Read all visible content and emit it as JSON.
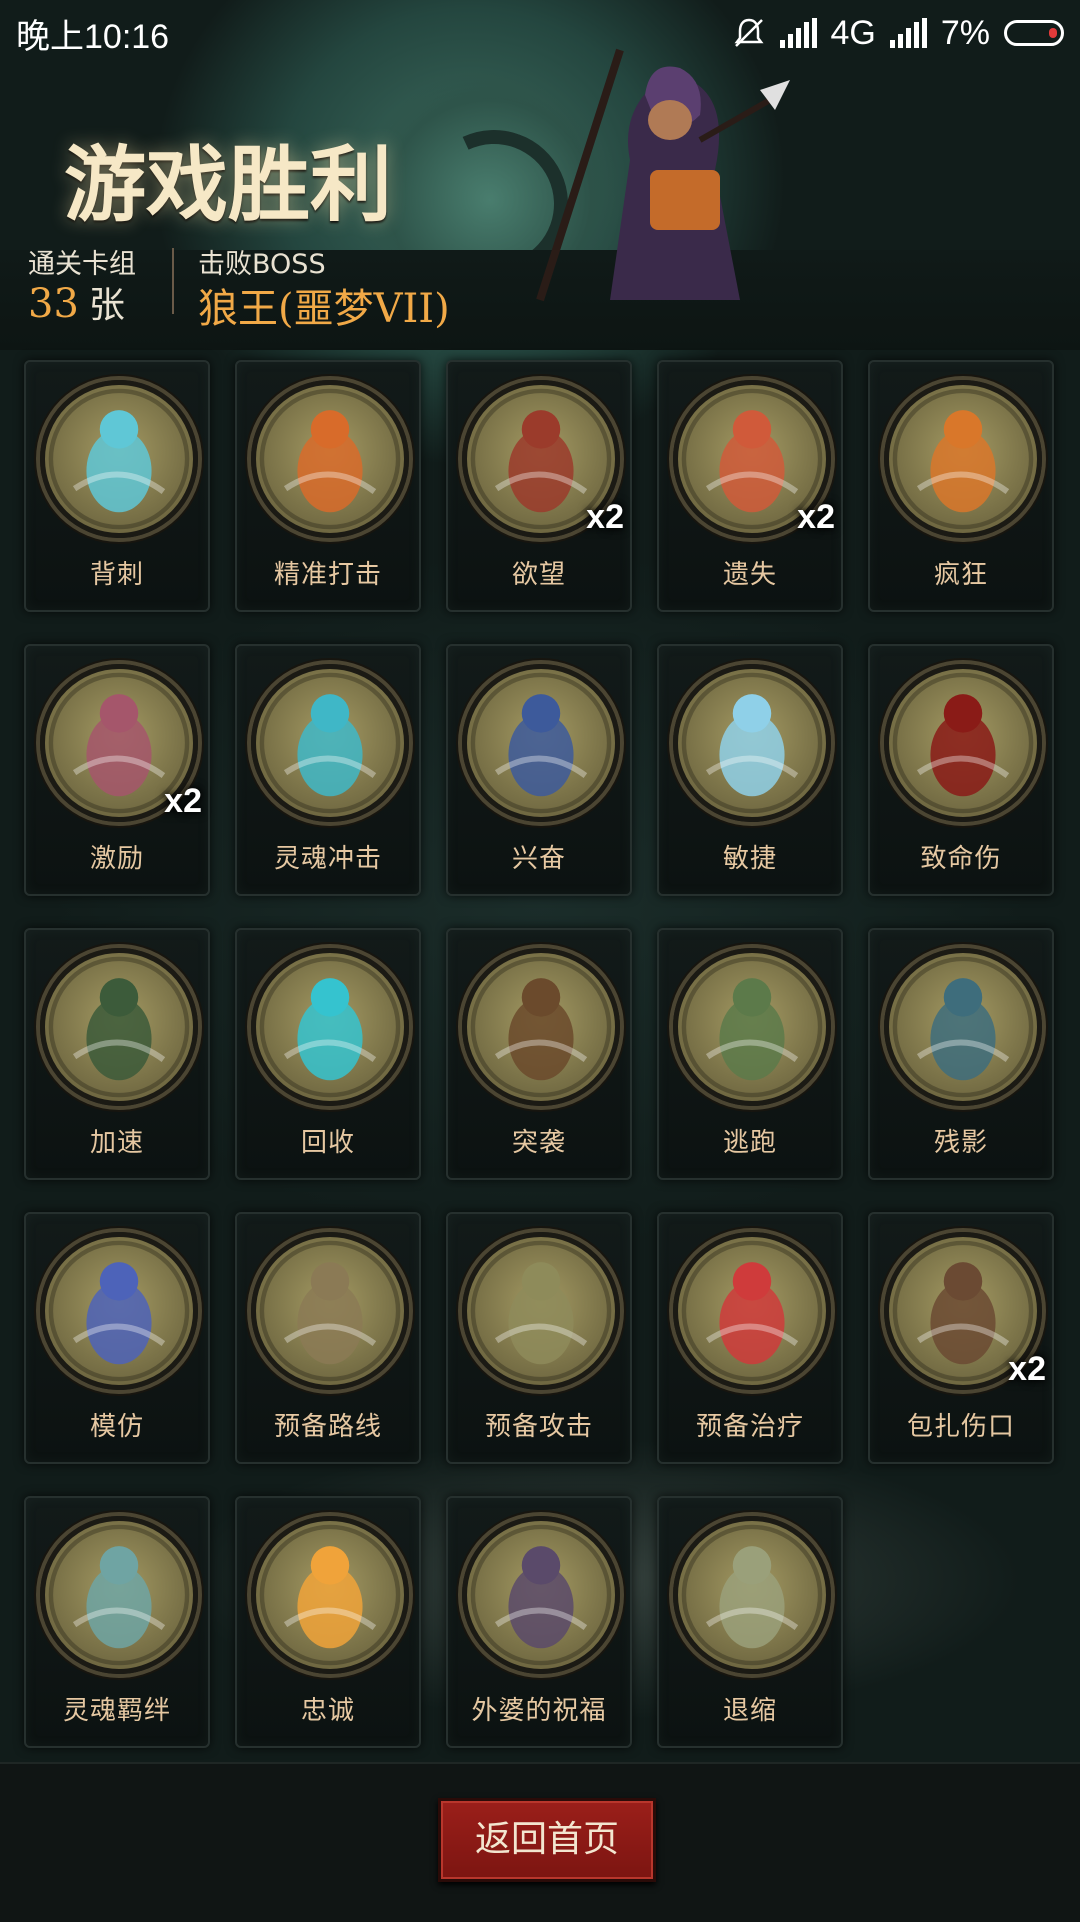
{
  "status_bar": {
    "time": "晚上10:16",
    "network": "4G",
    "battery": "7%",
    "icons": [
      "mute-bell-icon",
      "signal-icon",
      "signal-icon",
      "battery-icon"
    ]
  },
  "header": {
    "title": "游戏胜利",
    "cleared_deck_label": "通关卡组",
    "cleared_deck_count": "33",
    "cleared_deck_unit": "张",
    "boss_label": "击败BOSS",
    "boss_name": "狼王(噩梦VII)"
  },
  "cards": [
    {
      "label": "背刺",
      "multiplier": "",
      "icon": "lunging-figure-icon",
      "color": "#5fc7d6"
    },
    {
      "label": "精准打击",
      "multiplier": "",
      "icon": "target-icon",
      "color": "#d86b2a"
    },
    {
      "label": "欲望",
      "multiplier": "x2",
      "icon": "greedy-king-icon",
      "color": "#9b3b2b"
    },
    {
      "label": "遗失",
      "multiplier": "x2",
      "icon": "thief-icon",
      "color": "#d05a3a"
    },
    {
      "label": "疯狂",
      "multiplier": "",
      "icon": "pumpkin-head-icon",
      "color": "#d9772a"
    },
    {
      "label": "激励",
      "multiplier": "x2",
      "icon": "hammer-brute-icon",
      "color": "#a5566b"
    },
    {
      "label": "灵魂冲击",
      "multiplier": "",
      "icon": "soul-skull-icon",
      "color": "#3fb7c7"
    },
    {
      "label": "兴奋",
      "multiplier": "",
      "icon": "excited-worker-icon",
      "color": "#3d5a9b"
    },
    {
      "label": "敏捷",
      "multiplier": "",
      "icon": "panther-icon",
      "color": "#8fd0e8"
    },
    {
      "label": "致命伤",
      "multiplier": "",
      "icon": "bleeding-dagger-icon",
      "color": "#8a1b17"
    },
    {
      "label": "加速",
      "multiplier": "",
      "icon": "witch-icon",
      "color": "#3c5b3a"
    },
    {
      "label": "回收",
      "multiplier": "",
      "icon": "boomerang-icon",
      "color": "#35c3cf"
    },
    {
      "label": "突袭",
      "multiplier": "",
      "icon": "ambush-icon",
      "color": "#6b4a2c"
    },
    {
      "label": "逃跑",
      "multiplier": "",
      "icon": "running-man-icon",
      "color": "#5c7a4a"
    },
    {
      "label": "残影",
      "multiplier": "",
      "icon": "hooded-shadows-icon",
      "color": "#3e6d7c"
    },
    {
      "label": "模仿",
      "multiplier": "",
      "icon": "goblin-face-icon",
      "color": "#4d63b9"
    },
    {
      "label": "预备路线",
      "multiplier": "",
      "icon": "map-route-icon",
      "color": "#8b7a55"
    },
    {
      "label": "预备攻击",
      "multiplier": "",
      "icon": "wooden-soldier-icon",
      "color": "#8e8b5a"
    },
    {
      "label": "预备治疗",
      "multiplier": "",
      "icon": "heart-cross-icon",
      "color": "#cf3b3b"
    },
    {
      "label": "包扎伤口",
      "multiplier": "x2",
      "icon": "plague-doctor-icon",
      "color": "#6b4a33"
    },
    {
      "label": "灵魂羁绊",
      "multiplier": "",
      "icon": "twin-dolls-icon",
      "color": "#6fa4a3"
    },
    {
      "label": "忠诚",
      "multiplier": "",
      "icon": "cross-icon",
      "color": "#f0a33a"
    },
    {
      "label": "外婆的祝福",
      "multiplier": "",
      "icon": "grandma-book-icon",
      "color": "#5a4a6a"
    },
    {
      "label": "退缩",
      "multiplier": "",
      "icon": "retreat-doll-icon",
      "color": "#9aa07a"
    }
  ],
  "footer": {
    "home_button": "返回首页"
  }
}
